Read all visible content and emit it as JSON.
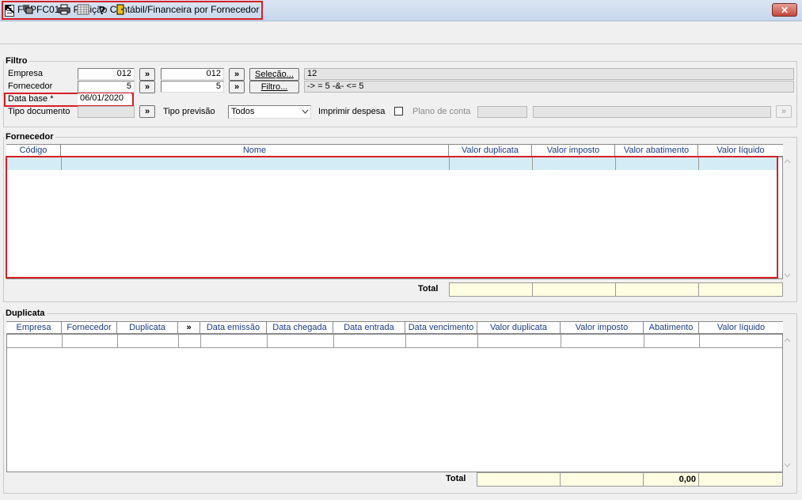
{
  "window": {
    "title": "FCPFC014 - Posição Contábil/Financeira por Fornecedor",
    "close_label": "✕"
  },
  "toolbar": {
    "icons": [
      "arrow-in-icon",
      "window-icon",
      "print-icon",
      "calendar-icon",
      "help-icon",
      "exit-door-icon"
    ]
  },
  "filtro": {
    "group_label": "Filtro",
    "empresa_label": "Empresa",
    "empresa_from": "012",
    "empresa_to": "012",
    "fornecedor_label": "Fornecedor",
    "fornecedor_from": "5",
    "fornecedor_to": "5",
    "data_base_label": "Data base *",
    "data_base_value": "06/01/2020",
    "tipo_documento_label": "Tipo documento",
    "tipo_documento_value": "",
    "selecao_button": "Seleção...",
    "filtro_button": "Filtro...",
    "selecao_text": "12",
    "filtro_text": "-> = 5 -&- <= 5",
    "tipo_previsao_label": "Tipo previsão",
    "tipo_previsao_value": "Todos",
    "imprimir_despesa_label": "Imprimir despesa",
    "plano_conta_label": "Plano de conta",
    "arrow": "»"
  },
  "fornecedor": {
    "group_label": "Fornecedor",
    "columns": [
      "Código",
      "Nome",
      "Valor duplicata",
      "Valor imposto",
      "Valor abatimento",
      "Valor líquido"
    ],
    "total_label": "Total",
    "totals": [
      "",
      "",
      "",
      ""
    ]
  },
  "duplicata": {
    "group_label": "Duplicata",
    "columns": [
      "Empresa",
      "Fornecedor",
      "Duplicata",
      "»",
      "Data emissão",
      "Data chegada",
      "Data entrada",
      "Data vencimento",
      "Valor duplicata",
      "Valor imposto",
      "Abatimento",
      "Valor líquido"
    ],
    "total_label": "Total",
    "totals": [
      "",
      "",
      "0,00",
      ""
    ]
  }
}
